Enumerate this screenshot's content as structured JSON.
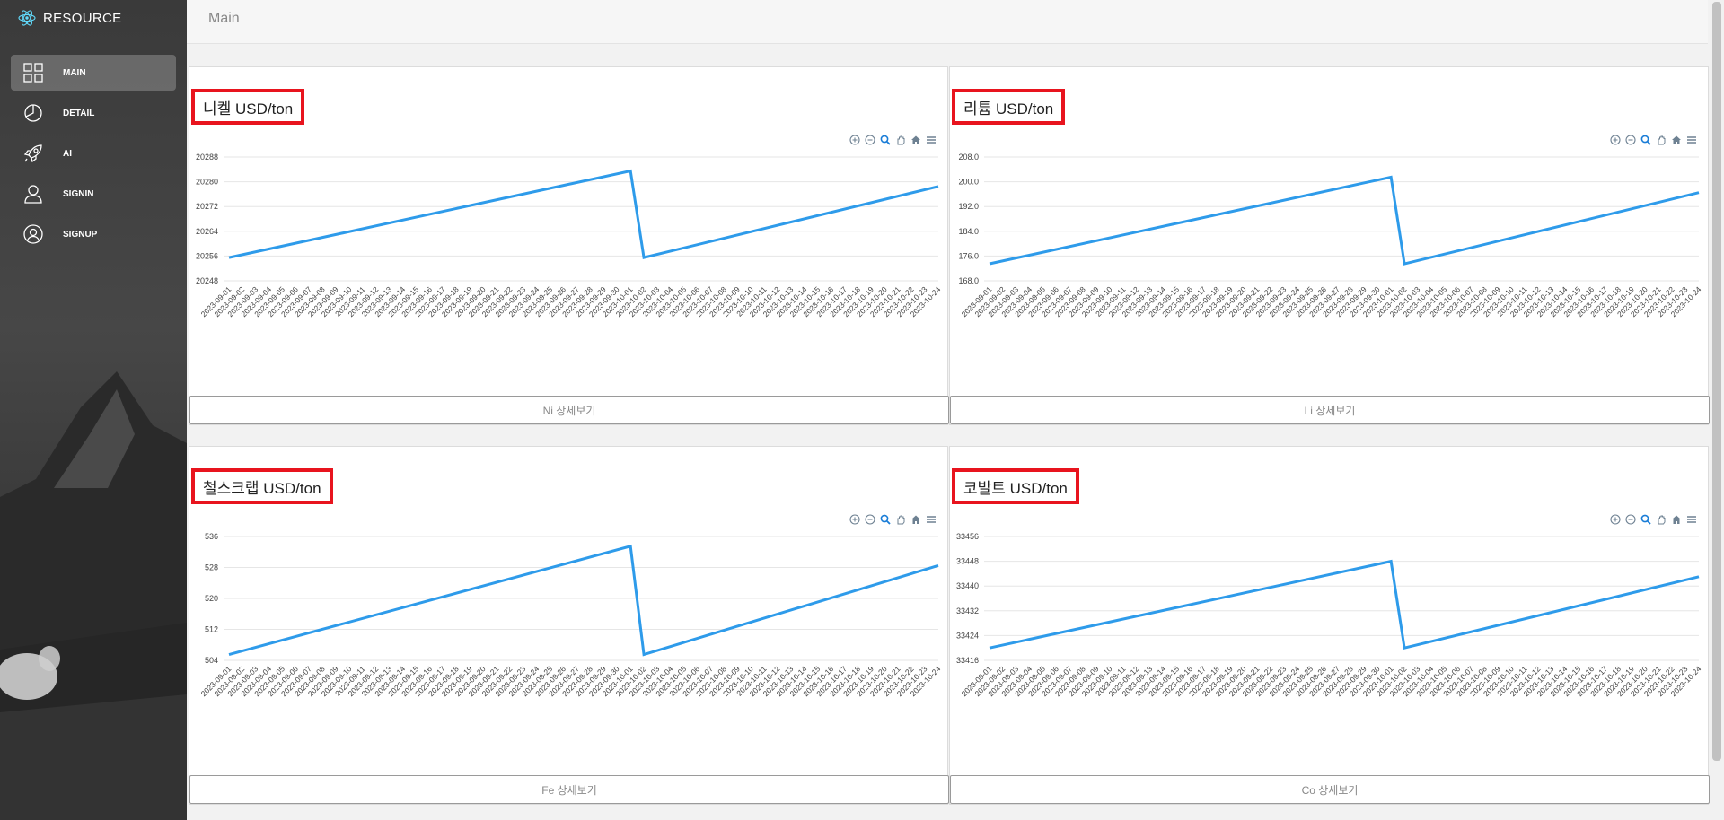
{
  "app": {
    "brand": "RESOURCE"
  },
  "sidebar": {
    "items": [
      {
        "label": "MAIN",
        "icon": "grid-icon",
        "active": true
      },
      {
        "label": "DETAIL",
        "icon": "pie-chart-icon",
        "active": false
      },
      {
        "label": "AI",
        "icon": "rocket-icon",
        "active": false
      },
      {
        "label": "SIGNIN",
        "icon": "user-icon",
        "active": false
      },
      {
        "label": "SIGNUP",
        "icon": "user-circle-icon",
        "active": false
      }
    ]
  },
  "header": {
    "title": "Main"
  },
  "colors": {
    "line": "#2e9bea",
    "highlight": "#e8141e",
    "sidebar": "#3a3a3a"
  },
  "toolbar_icons": [
    "zoom-in-icon",
    "zoom-out-icon",
    "selection-zoom-icon",
    "pan-icon",
    "reset-home-icon",
    "menu-icon"
  ],
  "cards": [
    {
      "title": "니켈 USD/ton",
      "button": "Ni 상세보기"
    },
    {
      "title": "리튬 USD/ton",
      "button": "Li 상세보기"
    },
    {
      "title": "철스크랩 USD/ton",
      "button": "Fe 상세보기"
    },
    {
      "title": "코발트 USD/ton",
      "button": "Co 상세보기"
    }
  ],
  "chart_data": [
    {
      "type": "line",
      "title": "니켈 USD/ton",
      "x_start": "2023-09-01",
      "x_end": "2023-10-24",
      "drop_after": "2023-10-01",
      "ylim": [
        20248,
        20288
      ],
      "yticks": [
        "20288",
        "20280",
        "20272",
        "20264",
        "20256",
        "20248"
      ],
      "points": [
        [
          "2023-09-01",
          20255.5
        ],
        [
          "2023-10-01",
          20283.5
        ],
        [
          "2023-10-02",
          20255.5
        ],
        [
          "2023-10-24",
          20278.5
        ]
      ]
    },
    {
      "type": "line",
      "title": "리튬 USD/ton",
      "x_start": "2023-09-01",
      "x_end": "2023-10-24",
      "drop_after": "2023-10-01",
      "ylim": [
        168.0,
        208.0
      ],
      "yticks": [
        "208.0",
        "200.0",
        "192.0",
        "184.0",
        "176.0",
        "168.0"
      ],
      "points": [
        [
          "2023-09-01",
          173.5
        ],
        [
          "2023-10-01",
          201.5
        ],
        [
          "2023-10-02",
          173.5
        ],
        [
          "2023-10-24",
          196.5
        ]
      ]
    },
    {
      "type": "line",
      "title": "철스크랩 USD/ton",
      "x_start": "2023-09-01",
      "x_end": "2023-10-24",
      "drop_after": "2023-10-01",
      "ylim": [
        504,
        536
      ],
      "yticks": [
        "536",
        "528",
        "520",
        "512",
        "504"
      ],
      "points": [
        [
          "2023-09-01",
          505.5
        ],
        [
          "2023-10-01",
          533.5
        ],
        [
          "2023-10-02",
          505.5
        ],
        [
          "2023-10-24",
          528.5
        ]
      ]
    },
    {
      "type": "line",
      "title": "코발트 USD/ton",
      "x_start": "2023-09-01",
      "x_end": "2023-10-24",
      "drop_after": "2023-10-01",
      "ylim": [
        33416,
        33456
      ],
      "yticks": [
        "33456",
        "33448",
        "33440",
        "33432",
        "33424",
        "33416"
      ],
      "points": [
        [
          "2023-09-01",
          33420
        ],
        [
          "2023-10-01",
          33448
        ],
        [
          "2023-10-02",
          33420
        ],
        [
          "2023-10-24",
          33443
        ]
      ]
    }
  ]
}
